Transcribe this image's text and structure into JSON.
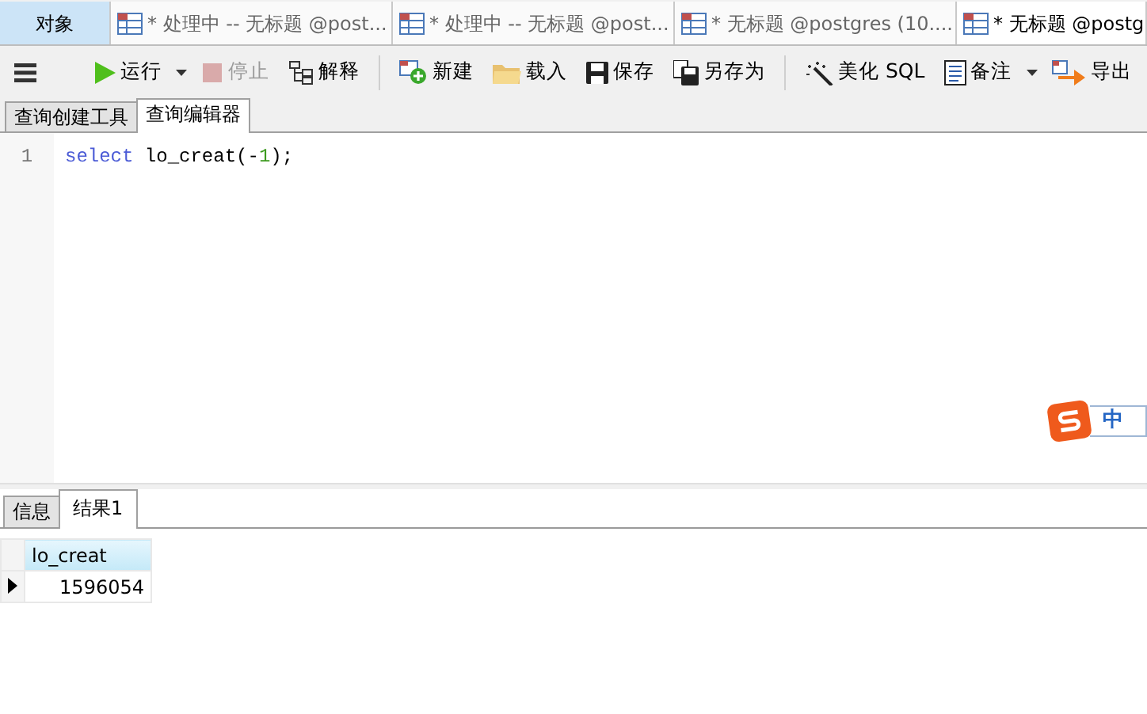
{
  "tabs": [
    {
      "label": "对象",
      "kind": "object",
      "selected": false
    },
    {
      "label": "* 处理中 -- 无标题 @post...",
      "kind": "query",
      "selected": false
    },
    {
      "label": "* 处理中 -- 无标题 @post...",
      "kind": "query",
      "selected": false
    },
    {
      "label": "* 无标题 @postgres (10....",
      "kind": "query",
      "selected": false
    },
    {
      "label": "* 无标题 @postg",
      "kind": "query",
      "selected": true
    }
  ],
  "toolbar": [
    {
      "kind": "menu"
    },
    {
      "kind": "run",
      "label": "运行",
      "dropdown": true,
      "disabled": false
    },
    {
      "kind": "stop",
      "label": "停止",
      "dropdown": false,
      "disabled": true
    },
    {
      "kind": "explain",
      "label": "解释",
      "dropdown": false,
      "disabled": false
    },
    {
      "kind": "separator"
    },
    {
      "kind": "new",
      "label": "新建",
      "dropdown": false,
      "disabled": false
    },
    {
      "kind": "load",
      "label": "载入",
      "dropdown": false,
      "disabled": false
    },
    {
      "kind": "save",
      "label": "保存",
      "dropdown": false,
      "disabled": false
    },
    {
      "kind": "saveas",
      "label": "另存为",
      "dropdown": false,
      "disabled": false
    },
    {
      "kind": "separator"
    },
    {
      "kind": "beautify",
      "label": "美化 SQL",
      "dropdown": false,
      "disabled": false
    },
    {
      "kind": "note",
      "label": "备注",
      "dropdown": true,
      "disabled": false
    },
    {
      "kind": "export",
      "label": "导出",
      "dropdown": false,
      "disabled": false
    }
  ],
  "editor_tabs": [
    {
      "label": "查询创建工具",
      "selected": false
    },
    {
      "label": "查询编辑器",
      "selected": true
    }
  ],
  "editor": {
    "lines": [
      {
        "number": "1",
        "tokens": [
          {
            "kind": "keyword",
            "text": "select"
          },
          {
            "kind": "plain",
            "text": " lo_creat("
          },
          {
            "kind": "plain",
            "text": "-"
          },
          {
            "kind": "number",
            "text": "1"
          },
          {
            "kind": "plain",
            "text": ");"
          }
        ]
      }
    ]
  },
  "ime": {
    "label": "中"
  },
  "result_tabs": [
    {
      "label": "信息",
      "selected": false
    },
    {
      "label": "结果1",
      "selected": true
    }
  ],
  "table": {
    "columns": [
      "lo_creat"
    ],
    "rows": [
      {
        "cells": [
          "1596054"
        ],
        "current": true
      }
    ]
  }
}
